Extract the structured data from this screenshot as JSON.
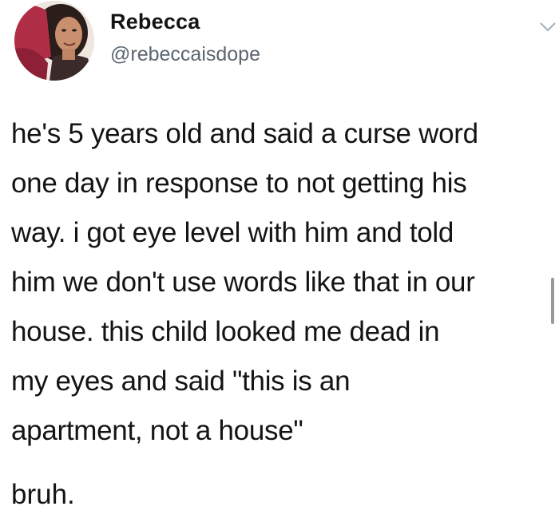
{
  "tweet": {
    "author": {
      "name": "Rebecca",
      "handle": "@rebeccaisdope",
      "avatar_icon": "profile-photo"
    },
    "menu_icon": "chevron-down-icon",
    "text_lines": [
      "he's 5 years old and said a curse word",
      "one day in response to not getting his",
      "way. i got eye level with him and told",
      "him we don't use words like that in our",
      "house. this child looked me dead in",
      "my eyes and said \"this is an",
      "apartment, not a house\""
    ],
    "closing": "bruh."
  },
  "colors": {
    "text": "#141414",
    "handle": "#5b6670",
    "chevron": "#9fb0bd",
    "background": "#ffffff"
  }
}
